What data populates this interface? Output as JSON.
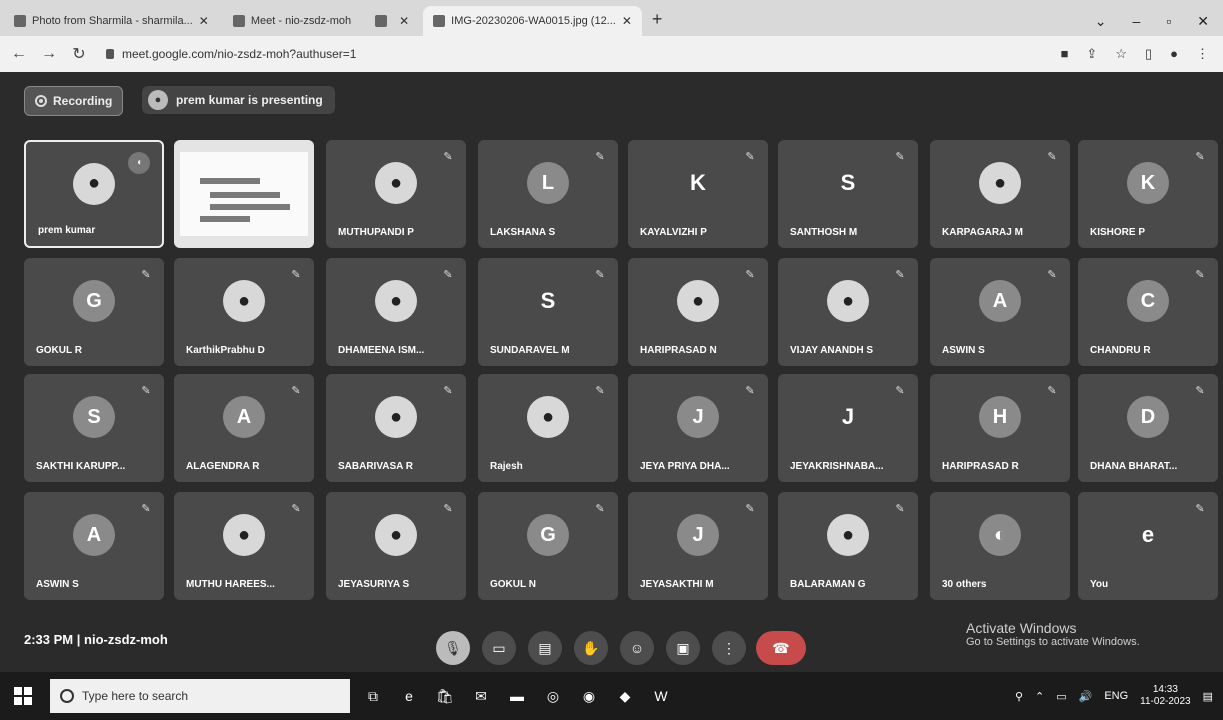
{
  "browser": {
    "tabs": [
      {
        "label": "Photo from Sharmila - sharmila..."
      },
      {
        "label": "Meet - nio-zsdz-moh"
      },
      {
        "label": ""
      },
      {
        "label": "IMG-20230206-WA0015.jpg (12..."
      }
    ],
    "url": "meet.google.com/nio-zsdz-moh?authuser=1"
  },
  "meet": {
    "recording_label": "Recording",
    "presenting_label": "prem kumar is presenting",
    "time": "2:33 PM",
    "separator": "|",
    "meeting_code": "nio-zsdz-moh",
    "activate_title": "Activate Windows",
    "activate_sub": "Go to Settings to activate Windows."
  },
  "participants": [
    {
      "name": "prem kumar",
      "avatar": "photo",
      "letter": "",
      "highlight": true
    },
    {
      "name": "",
      "avatar": "screen",
      "letter": ""
    },
    {
      "name": "MUTHUPANDI P",
      "avatar": "photo",
      "letter": ""
    },
    {
      "name": "LAKSHANA S",
      "avatar": "letter",
      "letter": "L"
    },
    {
      "name": "KAYALVIZHI P",
      "avatar": "letteronly",
      "letter": "K"
    },
    {
      "name": "SANTHOSH M",
      "avatar": "letteronly",
      "letter": "S"
    },
    {
      "name": "KARPAGARAJ M",
      "avatar": "photo",
      "letter": ""
    },
    {
      "name": "KISHORE P",
      "avatar": "letter",
      "letter": "K"
    },
    {
      "name": "GOKUL R",
      "avatar": "letter",
      "letter": "G"
    },
    {
      "name": "KarthikPrabhu D",
      "avatar": "photo",
      "letter": ""
    },
    {
      "name": "DHAMEENA ISM...",
      "avatar": "photo",
      "letter": ""
    },
    {
      "name": "SUNDARAVEL M",
      "avatar": "letteronly",
      "letter": "S"
    },
    {
      "name": "HARIPRASAD N",
      "avatar": "photo",
      "letter": ""
    },
    {
      "name": "VIJAY ANANDH S",
      "avatar": "photo",
      "letter": ""
    },
    {
      "name": "ASWIN S",
      "avatar": "letter",
      "letter": "A"
    },
    {
      "name": "CHANDRU R",
      "avatar": "letter",
      "letter": "C"
    },
    {
      "name": "SAKTHI KARUPP...",
      "avatar": "letter",
      "letter": "S"
    },
    {
      "name": "ALAGENDRA R",
      "avatar": "letter",
      "letter": "A"
    },
    {
      "name": "SABARIVASA R",
      "avatar": "photo",
      "letter": ""
    },
    {
      "name": "Rajesh",
      "avatar": "photo",
      "letter": ""
    },
    {
      "name": "JEYA PRIYA DHA...",
      "avatar": "letter",
      "letter": "J"
    },
    {
      "name": "JEYAKRISHNABA...",
      "avatar": "letteronly",
      "letter": "J"
    },
    {
      "name": "HARIPRASAD R",
      "avatar": "letter",
      "letter": "H"
    },
    {
      "name": "DHANA BHARAT...",
      "avatar": "letter",
      "letter": "D"
    },
    {
      "name": "ASWIN S",
      "avatar": "letter",
      "letter": "A"
    },
    {
      "name": "MUTHU HAREES...",
      "avatar": "photo",
      "letter": ""
    },
    {
      "name": "JEYASURIYA S",
      "avatar": "photo",
      "letter": ""
    },
    {
      "name": "GOKUL N",
      "avatar": "letter",
      "letter": "G"
    },
    {
      "name": "JEYASAKTHI M",
      "avatar": "letter",
      "letter": "J"
    },
    {
      "name": "BALARAMAN G",
      "avatar": "photo",
      "letter": ""
    },
    {
      "name": "30 others",
      "avatar": "others",
      "letter": ""
    },
    {
      "name": "You",
      "avatar": "letteronly",
      "letter": "e"
    }
  ],
  "taskbar": {
    "search_placeholder": "Type here to search",
    "lang": "ENG",
    "time": "14:33",
    "date": "11-02-2023"
  }
}
